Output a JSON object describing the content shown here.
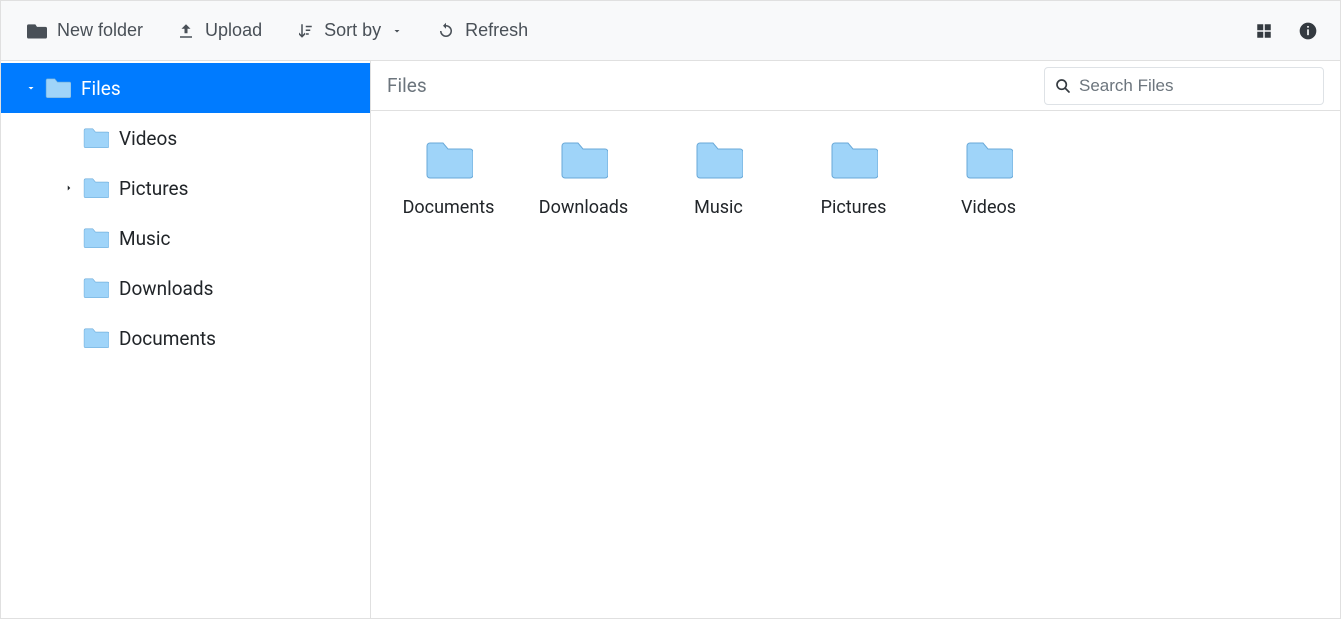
{
  "toolbar": {
    "new_folder": "New folder",
    "upload": "Upload",
    "sort_by": "Sort by",
    "refresh": "Refresh"
  },
  "sidebar": {
    "root": {
      "label": "Files",
      "expanded": true
    },
    "items": [
      {
        "label": "Videos",
        "expandable": false
      },
      {
        "label": "Pictures",
        "expandable": true
      },
      {
        "label": "Music",
        "expandable": false
      },
      {
        "label": "Downloads",
        "expandable": false
      },
      {
        "label": "Documents",
        "expandable": false
      }
    ]
  },
  "main": {
    "breadcrumb": "Files",
    "search_placeholder": "Search Files",
    "folders": [
      {
        "label": "Documents"
      },
      {
        "label": "Downloads"
      },
      {
        "label": "Music"
      },
      {
        "label": "Pictures"
      },
      {
        "label": "Videos"
      }
    ]
  },
  "colors": {
    "primary": "#007bff",
    "folder_fill": "#9fd4f9",
    "folder_stroke": "#6aa9d8",
    "toolbar_bg": "#f8f9fa"
  }
}
